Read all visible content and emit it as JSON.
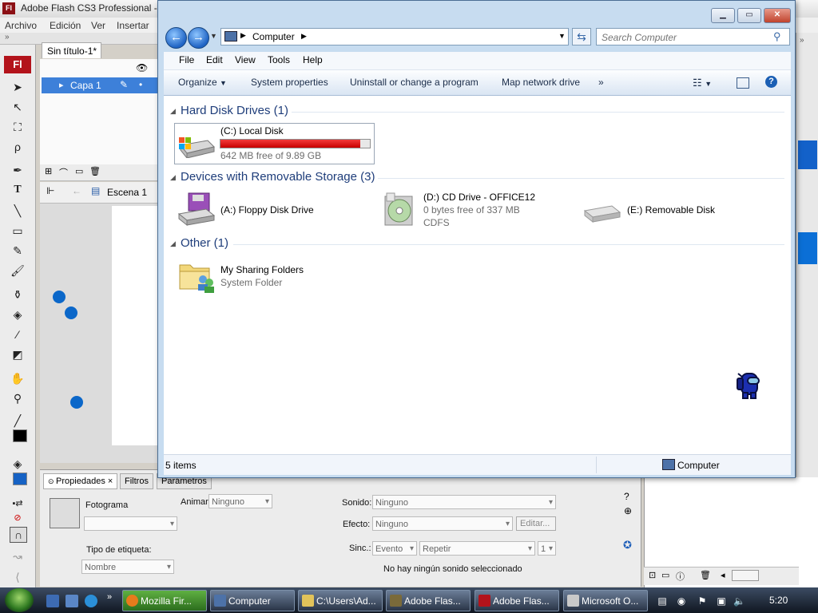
{
  "flash": {
    "title": "Adobe Flash CS3 Professional - [",
    "menu": [
      "Archivo",
      "Edición",
      "Ver",
      "Insertar"
    ],
    "doc_tab": "Sin título-1*",
    "layer": "Capa 1",
    "scene": "Escena 1",
    "props": {
      "tabs": [
        "Propiedades",
        "Filtros",
        "Parámetros"
      ],
      "frame_label": "Fotograma",
      "label_type": "Tipo de etiqueta:",
      "label_type_value": "Nombre",
      "animate_label": "Animar:",
      "animate_value": "Ninguno",
      "sound_label": "Sonido:",
      "sound_value": "Ninguno",
      "effect_label": "Efecto:",
      "effect_value": "Ninguno",
      "edit_button": "Editar...",
      "sync_label": "Sinc.:",
      "sync_value": "Evento",
      "repeat_value": "Repetir",
      "repeat_count": "1",
      "no_sound": "No hay ningún sonido seleccionado"
    }
  },
  "explorer": {
    "address": "Computer",
    "search_placeholder": "Search Computer",
    "menu": [
      "File",
      "Edit",
      "View",
      "Tools",
      "Help"
    ],
    "commands": {
      "organize": "Organize",
      "system_properties": "System properties",
      "uninstall": "Uninstall or change a program",
      "map_drive": "Map network drive",
      "more": "»"
    },
    "groups": {
      "hard_disks": "Hard Disk Drives (1)",
      "removable": "Devices with Removable Storage (3)",
      "other": "Other (1)"
    },
    "drives": {
      "c_name": "(C:) Local Disk",
      "c_free": "642 MB free of 9.89 GB",
      "c_used_fraction": 0.937,
      "a_name": "(A:) Floppy Disk Drive",
      "d_name": "(D:) CD Drive - OFFICE12",
      "d_free": "0 bytes free of 337 MB",
      "d_fs": "CDFS",
      "e_name": "(E:) Removable Disk",
      "sharing_name": "My Sharing Folders",
      "sharing_type": "System Folder"
    },
    "status": {
      "count": "5 items",
      "location": "Computer"
    }
  },
  "taskbar": {
    "buttons": [
      "Mozilla Fir...",
      "Computer",
      "C:\\Users\\Ad...",
      "Adobe Flas...",
      "Adobe Flas...",
      "Microsoft O..."
    ],
    "clock": "5:20"
  },
  "colors": {
    "flash_red": "#b3131b",
    "disk_bar": "#d40000",
    "dot_blue": "#0b67c9",
    "heading_blue": "#1e3d7a"
  }
}
